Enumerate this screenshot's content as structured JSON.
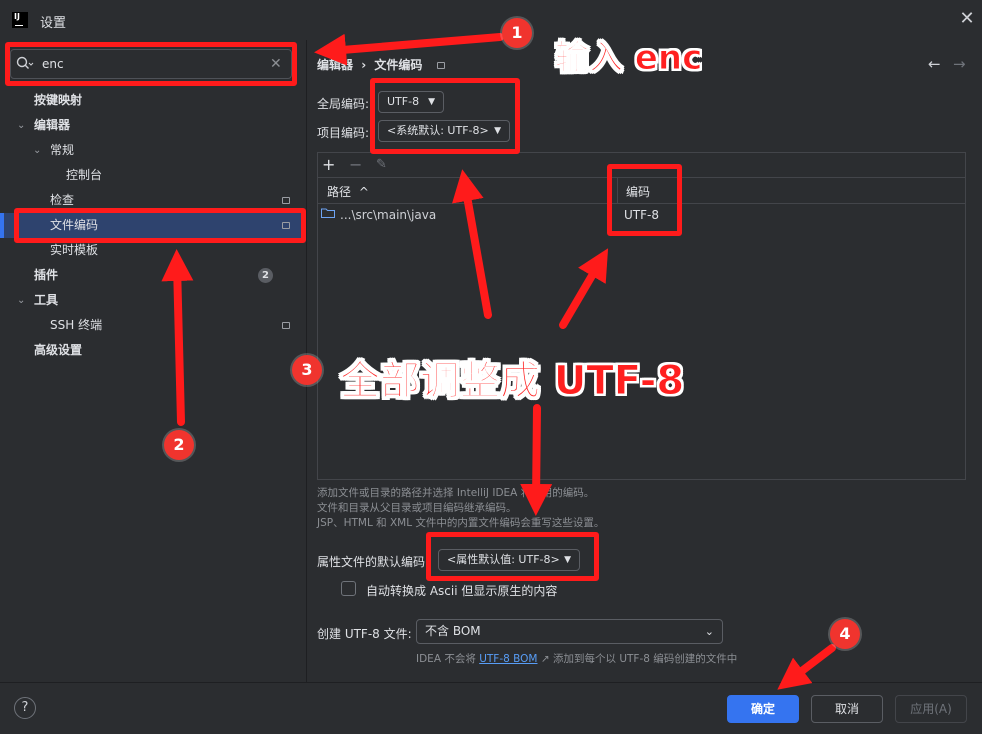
{
  "window": {
    "title": "设置",
    "app_icon_text": "IJ"
  },
  "search": {
    "value": "enc"
  },
  "sidebar": {
    "items": [
      {
        "label": "按键映射"
      },
      {
        "label": "编辑器"
      },
      {
        "label": "常规"
      },
      {
        "label": "控制台"
      },
      {
        "label": "检查"
      },
      {
        "label": "文件编码"
      },
      {
        "label": "实时模板"
      },
      {
        "label": "插件",
        "badge": "2"
      },
      {
        "label": "工具"
      },
      {
        "label": "SSH 终端"
      },
      {
        "label": "高级设置"
      }
    ]
  },
  "breadcrumb": {
    "parent": "编辑器",
    "separator": "›",
    "current": "文件编码"
  },
  "encoding": {
    "global_label": "全局编码:",
    "global_value": "UTF-8",
    "project_label": "项目编码:",
    "project_value": "<系统默认: UTF-8>"
  },
  "table": {
    "col_path": "路径",
    "col_path_sort": "^",
    "col_encoding": "编码",
    "rows": [
      {
        "path": "...\\src\\main\\java",
        "encoding": "UTF-8"
      }
    ]
  },
  "hints": {
    "line1": "添加文件或目录的路径并选择 IntelliJ IDEA 将使用的编码。",
    "line2": "文件和目录从父目录或项目编码继承编码。",
    "line3": "JSP、HTML 和 XML 文件中的内置文件编码会重写这些设置。"
  },
  "properties": {
    "label": "属性文件的默认编码",
    "value": "<属性默认值: UTF-8>",
    "transparent_ascii": "自动转换成 Ascii 但显示原生的内容"
  },
  "bom": {
    "label": "创建 UTF-8 文件:",
    "value": "不含 BOM",
    "hint_prefix": "IDEA 不会将",
    "hint_link": "UTF-8 BOM",
    "hint_suffix": "添加到每个以 UTF-8 编码创建的文件中"
  },
  "footer": {
    "help": "?",
    "ok": "确定",
    "cancel": "取消",
    "apply": "应用(A)"
  },
  "annotations": {
    "step1_num": "1",
    "step1_text": "输入 enc",
    "step2_num": "2",
    "step3_num": "3",
    "step3_text": "全部调整成 UTF-8",
    "step4_num": "4",
    "color": "#ff1b1b"
  },
  "colors": {
    "accent": "#3574f0",
    "selection": "#2e436e",
    "link": "#589df6",
    "background": "#2b2d30"
  }
}
